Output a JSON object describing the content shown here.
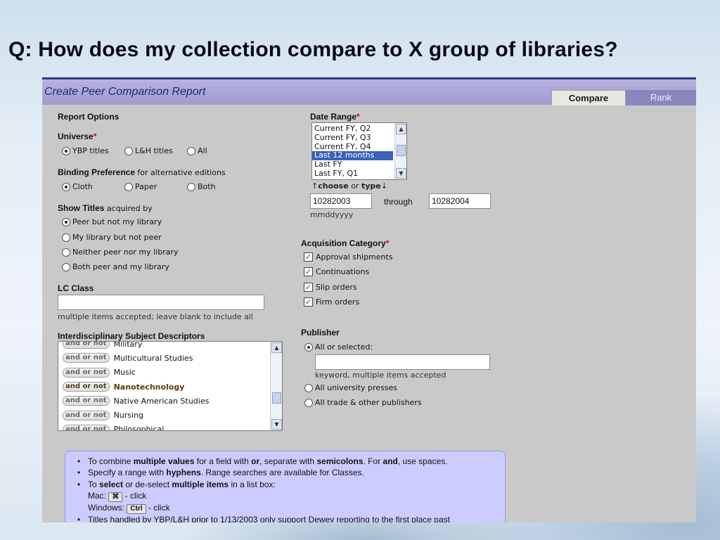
{
  "slide": {
    "title": "Q: How does my collection compare to X group of libraries?"
  },
  "panel": {
    "title": "Create Peer Comparison Report",
    "tabs": {
      "compare": "Compare",
      "rank": "Rank"
    }
  },
  "report_options": {
    "label": "Report Options"
  },
  "universe": {
    "label": "Universe",
    "required_mark": "*",
    "options": [
      "YBP titles",
      "L&H titles",
      "All"
    ],
    "selected": "YBP titles"
  },
  "binding": {
    "label": "Binding Preference",
    "sublabel": "for alternative editions",
    "options": [
      "Cloth",
      "Paper",
      "Both"
    ],
    "selected": "Cloth"
  },
  "show_titles": {
    "label": "Show Titles",
    "sublabel": "acquired by",
    "options": [
      "Peer but not my library",
      "My library but not peer",
      "Neither peer nor my library",
      "Both peer and my library"
    ],
    "selected": "Peer but not my library"
  },
  "lc_class": {
    "label": "LC Class",
    "value": "",
    "hint": "multiple items accepted; leave blank to include all"
  },
  "subjects": {
    "label": "Interdisciplinary Subject Descriptors",
    "pill": "and or not",
    "items": [
      "Military",
      "Multicultural Studies",
      "Music",
      "Nanotechnology",
      "Native American Studies",
      "Nursing",
      "Philosophical"
    ],
    "highlighted": "Nanotechnology"
  },
  "date_range": {
    "label": "Date Range",
    "required_mark": "*",
    "options": [
      "Current FY, Q2",
      "Current FY, Q3",
      "Current FY, Q4",
      "Last 12 months",
      "Last FY",
      "Last FY, Q1"
    ],
    "selected": "Last 12 months",
    "choose_text": "choose",
    "or_text": "or",
    "type_text": "type",
    "from_value": "10282003",
    "through_label": "through",
    "to_value": "10282004",
    "format_hint": "mmddyyyy"
  },
  "acquisition": {
    "label": "Acquisition Category",
    "required_mark": "*",
    "options": [
      "Approval shipments",
      "Continuations",
      "Slip orders",
      "Firm orders"
    ],
    "checked": [
      true,
      true,
      true,
      true
    ]
  },
  "publisher": {
    "label": "Publisher",
    "option_all": "All or selected:",
    "value": "",
    "hint": "keyword, multiple items accepted",
    "option_univ": "All university presses",
    "option_trade": "All trade & other publishers",
    "selected": "All or selected:"
  },
  "help": {
    "l1_a": "To combine ",
    "l1_b": "multiple values",
    "l1_c": " for a field with ",
    "l1_d": "or",
    "l1_e": ", separate with ",
    "l1_f": "semicolons",
    "l1_g": ". For ",
    "l1_h": "and",
    "l1_i": ", use spaces.",
    "l2_a": "Specify a range with ",
    "l2_b": "hyphens",
    "l2_c": ". Range searches are available for Classes.",
    "l3_a": "To ",
    "l3_b": "select",
    "l3_c": " or de-select ",
    "l3_d": "multiple items",
    "l3_e": " in a list box:",
    "mac_label": "Mac:",
    "mac_key": "⌘",
    "click": " - click",
    "win_label": "Windows:",
    "win_key": "Ctrl",
    "l4": "Titles handled by YBP/L&H prior to 1/13/2003 only support Dewey reporting to the first place past"
  }
}
